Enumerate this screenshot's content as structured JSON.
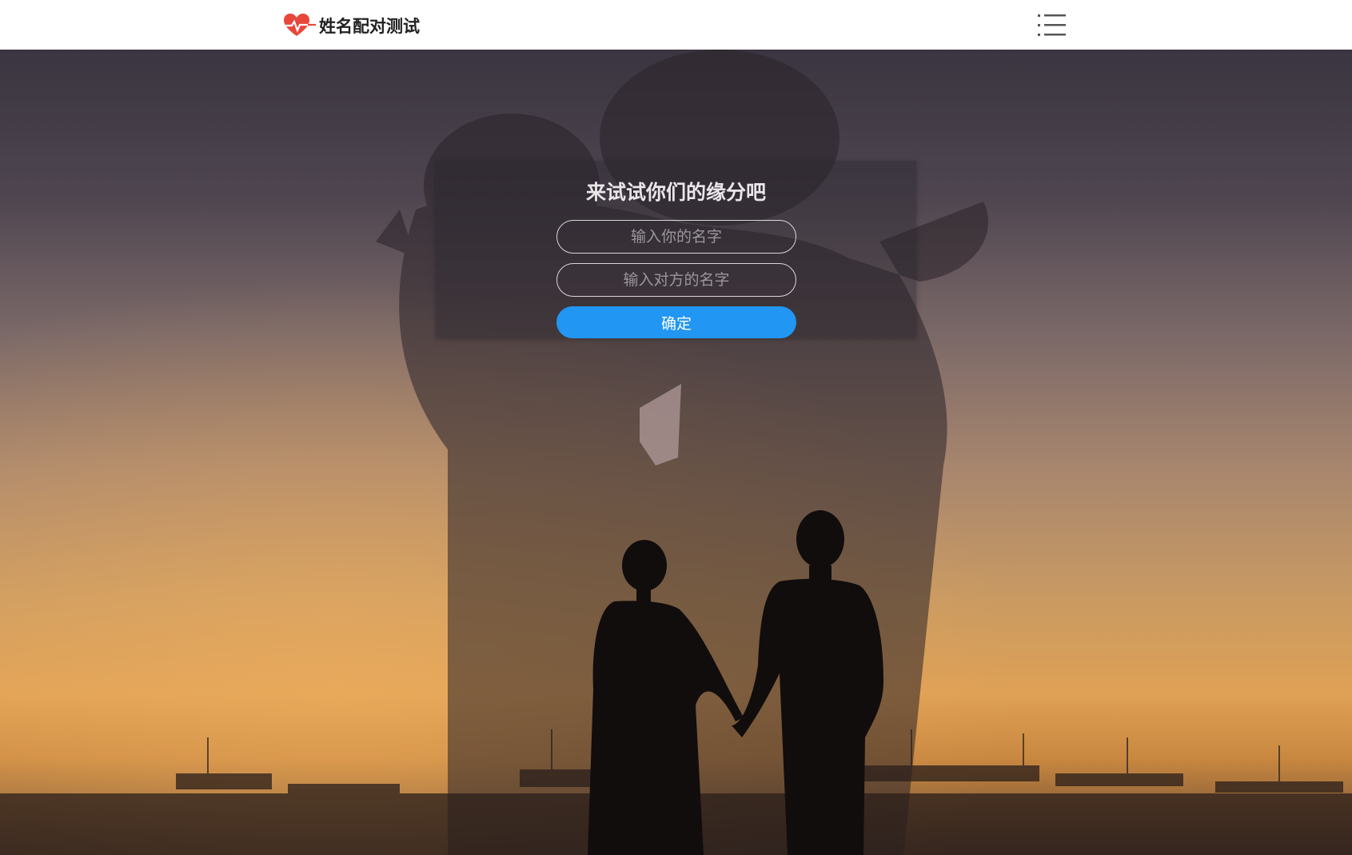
{
  "header": {
    "brand": "姓名配对测试",
    "logo_icon": "heart-pulse-icon",
    "menu_icon": "menu-list-icon"
  },
  "form": {
    "title": "来试试你们的缘分吧",
    "your_name_placeholder": "输入你的名字",
    "partner_name_placeholder": "输入对方的名字",
    "your_name_value": "",
    "partner_name_value": "",
    "submit_label": "确定"
  },
  "theme": {
    "accent": "#2196f3",
    "logo_red": "#e8473b",
    "header_bg": "#ffffff"
  }
}
